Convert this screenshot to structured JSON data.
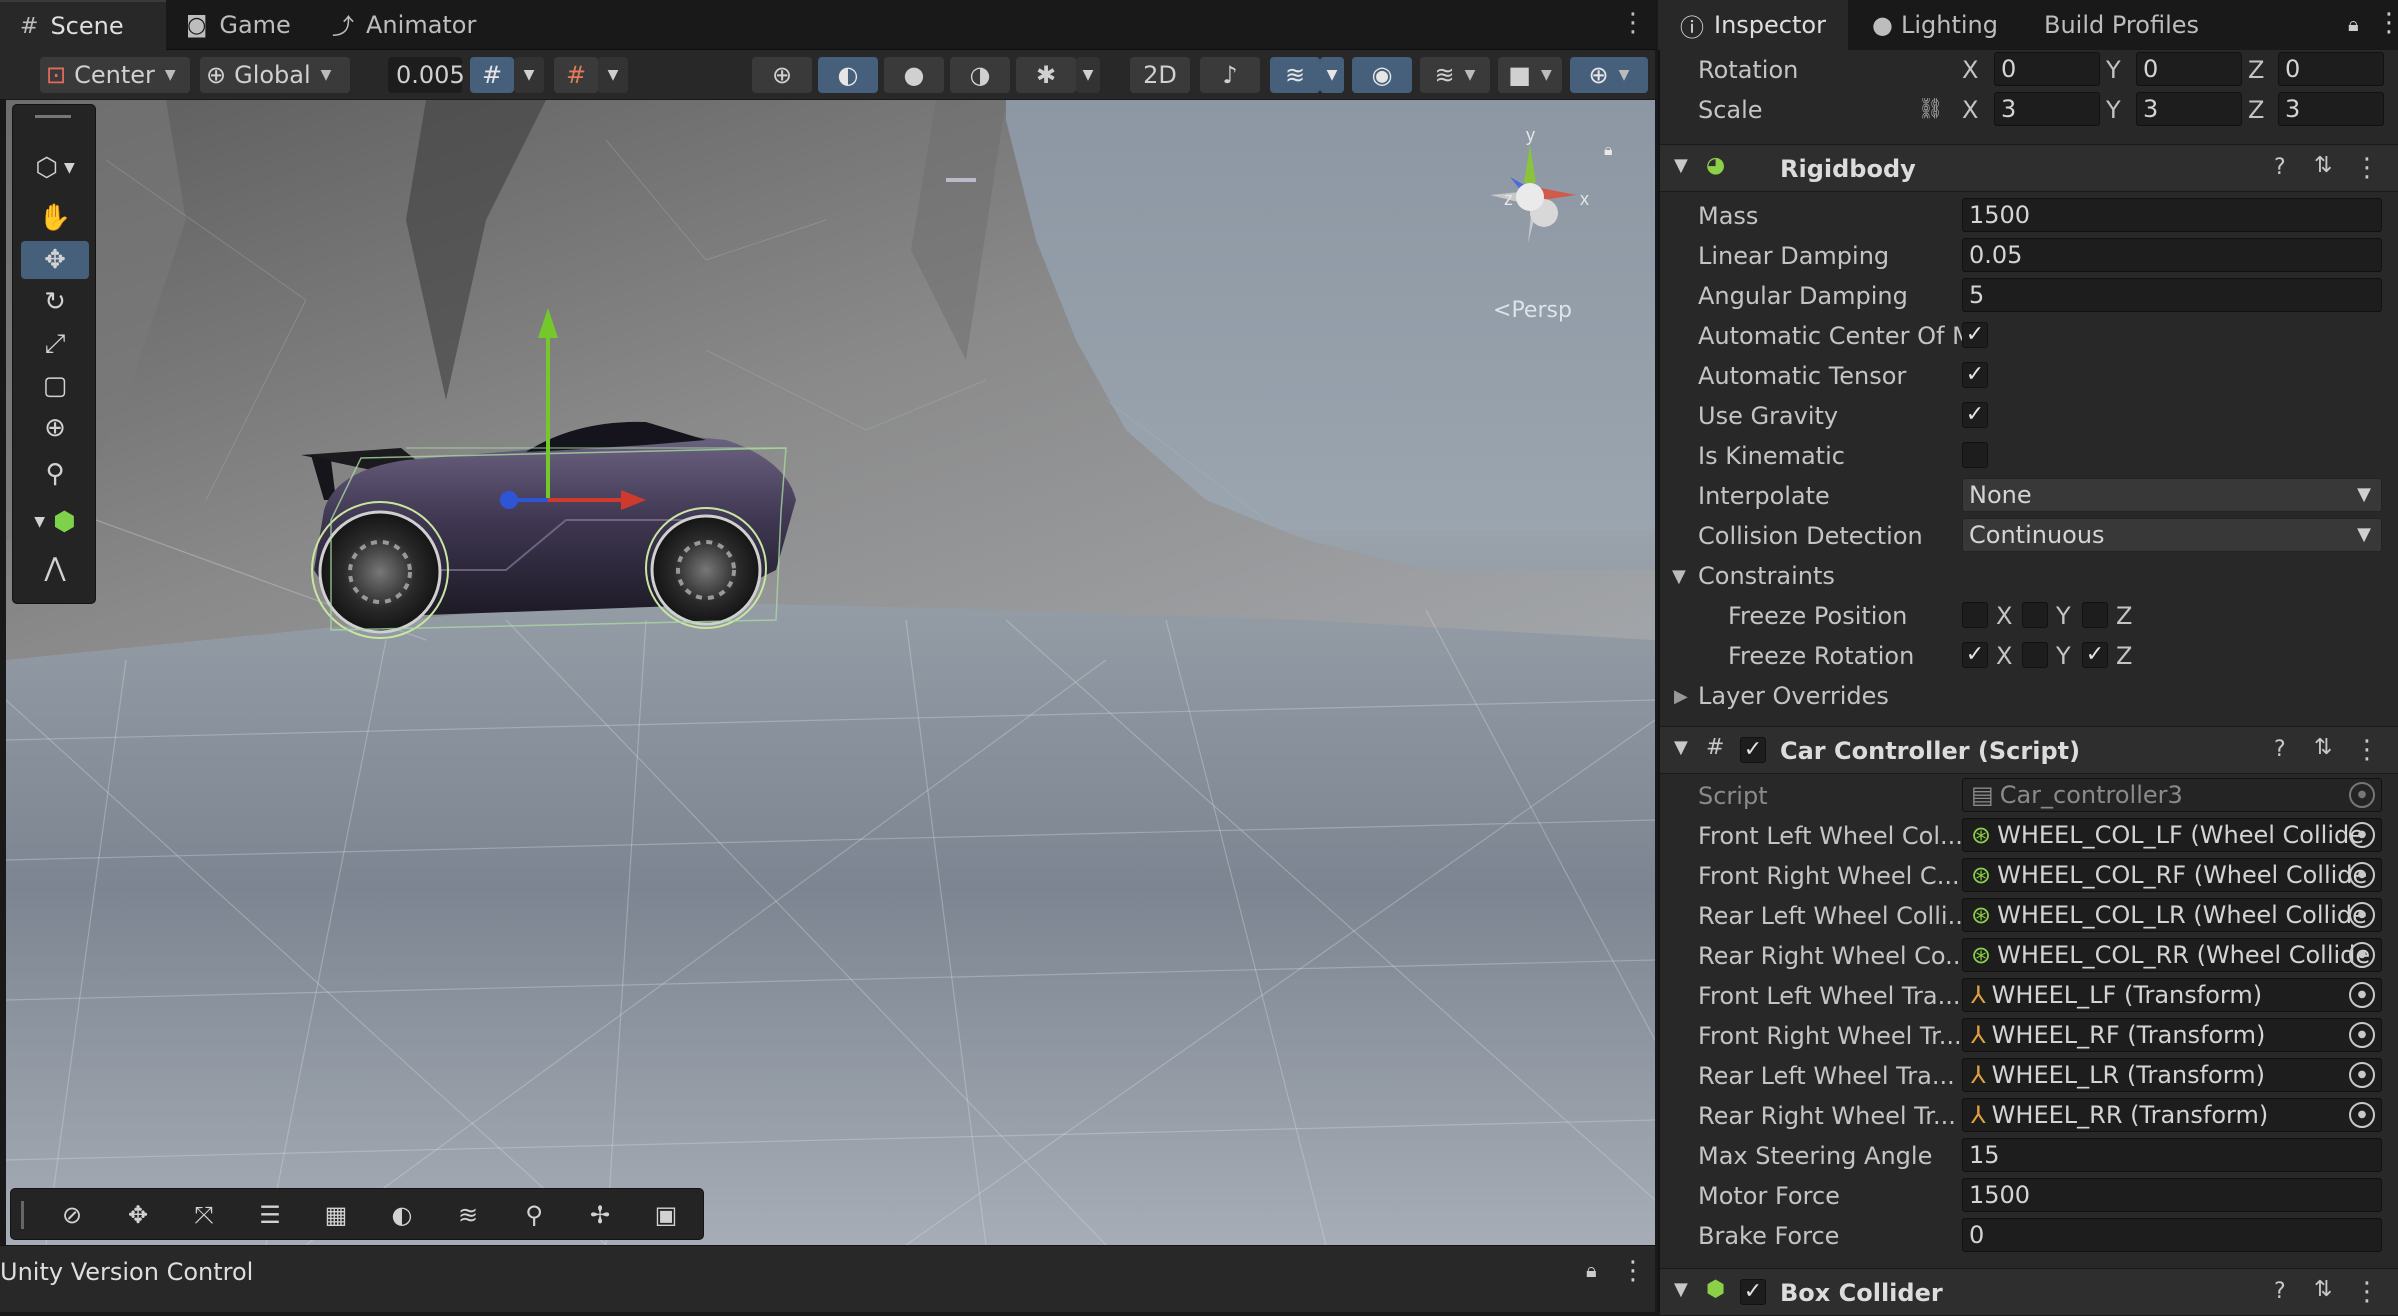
{
  "scene_tabs": [
    {
      "label": "Scene",
      "icon": "grid-icon"
    },
    {
      "label": "Game",
      "icon": "gamepad-icon"
    },
    {
      "label": "Animator",
      "icon": "animator-icon"
    }
  ],
  "scene_toolbar": {
    "pivot_mode": "Center",
    "pivot_rotation": "Global",
    "snap_increment": "0.005"
  },
  "viewport": {
    "projection_label": "Persp",
    "axis_labels": {
      "x": "x",
      "y": "y",
      "z": "z"
    }
  },
  "version_control": {
    "title": "Unity Version Control"
  },
  "inspector_tabs": [
    {
      "label": "Inspector",
      "icon": "info-icon"
    },
    {
      "label": "Lighting",
      "icon": "bulb-icon"
    },
    {
      "label": "Build Profiles",
      "icon": ""
    }
  ],
  "transform": {
    "rotation": {
      "label": "Rotation",
      "x": "0",
      "y": "0",
      "z": "0"
    },
    "scale": {
      "label": "Scale",
      "x": "3",
      "y": "3",
      "z": "3"
    },
    "axis_x": "X",
    "axis_y": "Y",
    "axis_z": "Z"
  },
  "rigidbody": {
    "title": "Rigidbody",
    "mass": {
      "label": "Mass",
      "value": "1500"
    },
    "linear_damping": {
      "label": "Linear Damping",
      "value": "0.05"
    },
    "angular_damping": {
      "label": "Angular Damping",
      "value": "5"
    },
    "auto_center": {
      "label": "Automatic Center Of M",
      "checked": true
    },
    "auto_tensor": {
      "label": "Automatic Tensor",
      "checked": true
    },
    "use_gravity": {
      "label": "Use Gravity",
      "checked": true
    },
    "is_kinematic": {
      "label": "Is Kinematic",
      "checked": false
    },
    "interpolate": {
      "label": "Interpolate",
      "value": "None"
    },
    "collision_detection": {
      "label": "Collision Detection",
      "value": "Continuous"
    },
    "constraints": {
      "label": "Constraints"
    },
    "freeze_position": {
      "label": "Freeze Position",
      "x": false,
      "y": false,
      "z": false
    },
    "freeze_rotation": {
      "label": "Freeze Rotation",
      "x": true,
      "y": false,
      "z": true
    },
    "layer_overrides": {
      "label": "Layer Overrides"
    }
  },
  "car_controller": {
    "title": "Car Controller (Script)",
    "script": {
      "label": "Script",
      "value": "Car_controller3"
    },
    "refs": [
      {
        "label": "Front Left Wheel Col...",
        "value": "WHEEL_COL_LF (Wheel Collide",
        "kind": "collider"
      },
      {
        "label": "Front Right Wheel C...",
        "value": "WHEEL_COL_RF (Wheel Collide",
        "kind": "collider"
      },
      {
        "label": "Rear Left Wheel Colli...",
        "value": "WHEEL_COL_LR (Wheel Collide",
        "kind": "collider"
      },
      {
        "label": "Rear Right Wheel Co...",
        "value": "WHEEL_COL_RR (Wheel Collide",
        "kind": "collider"
      },
      {
        "label": "Front Left Wheel Tra...",
        "value": "WHEEL_LF (Transform)",
        "kind": "transform"
      },
      {
        "label": "Front Right Wheel Tr...",
        "value": "WHEEL_RF (Transform)",
        "kind": "transform"
      },
      {
        "label": "Rear Left Wheel Tra...",
        "value": "WHEEL_LR (Transform)",
        "kind": "transform"
      },
      {
        "label": "Rear Right Wheel Tr...",
        "value": "WHEEL_RR (Transform)",
        "kind": "transform"
      }
    ],
    "max_steering": {
      "label": "Max Steering Angle",
      "value": "15"
    },
    "motor_force": {
      "label": "Motor Force",
      "value": "1500"
    },
    "brake_force": {
      "label": "Brake Force",
      "value": "0"
    }
  },
  "box_collider": {
    "title": "Box Collider"
  },
  "colors": {
    "accent_blue": "#46607c",
    "panel": "#282828",
    "field": "#1d1d1d"
  }
}
